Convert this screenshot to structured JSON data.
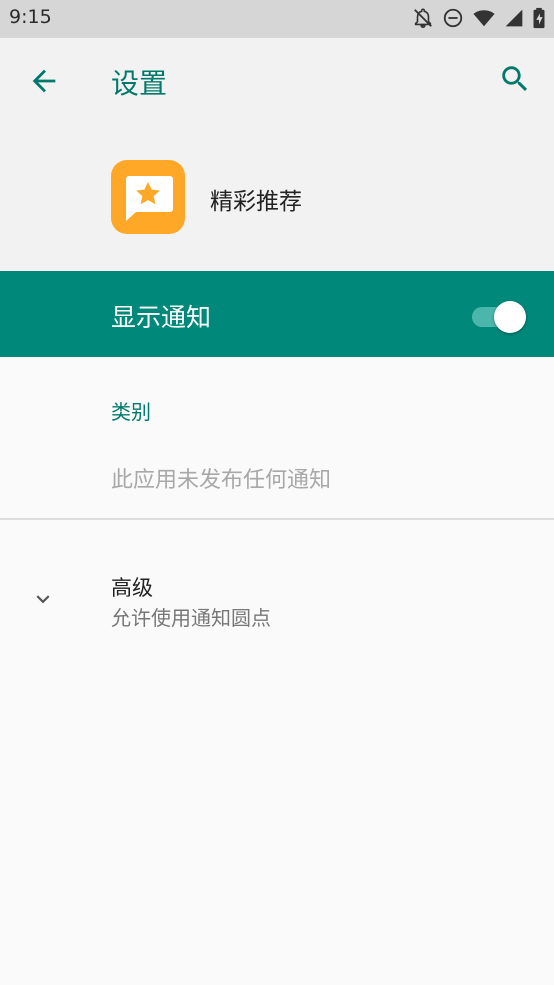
{
  "status_bar": {
    "time": "9:15",
    "icons": [
      "notifications-off-icon",
      "do-not-disturb-icon",
      "wifi-icon",
      "signal-icon",
      "battery-charging-icon"
    ]
  },
  "header": {
    "title": "设置",
    "back_icon": "arrow-back-icon",
    "search_icon": "search-icon",
    "app": {
      "name": "精彩推荐",
      "icon": "star-message-icon",
      "icon_color": "#ffa726"
    }
  },
  "notifications": {
    "label": "显示通知",
    "enabled": true,
    "accent": "#00897b"
  },
  "category": {
    "heading": "类别",
    "empty_message": "此应用未发布任何通知"
  },
  "advanced": {
    "title": "高级",
    "subtitle": "允许使用通知圆点"
  }
}
